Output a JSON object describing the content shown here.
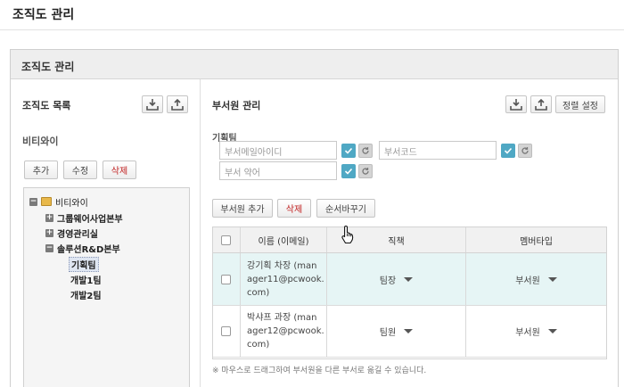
{
  "page": {
    "title": "조직도 관리"
  },
  "panel": {
    "title": "조직도 관리"
  },
  "org_list": {
    "title": "조직도 목록",
    "company": "비티와이",
    "buttons": {
      "add": "추가",
      "edit": "수정",
      "delete": "삭제"
    },
    "tree": {
      "root": "비티와이",
      "nodes": [
        "그룹웨어사업본부",
        "경영관리실",
        "솔루션R&D본부"
      ],
      "children": [
        "기획팀",
        "개발1팀",
        "개발2팀"
      ]
    }
  },
  "member_mgmt": {
    "title": "부서원 관리",
    "sort_label": "정렬 설정",
    "group_name": "기획팀",
    "fields": {
      "mail_id": "부서메일아이디",
      "dept_code": "부서코드",
      "dept_abbr": "부서 약어"
    },
    "actions": {
      "add": "부서원 추가",
      "delete": "삭제",
      "reorder": "순서바꾸기"
    },
    "table": {
      "headers": [
        "이름 (이메일)",
        "직책",
        "멤버타입"
      ],
      "rows": [
        {
          "name": [
            "강기획 차장 (man",
            "ager11@pcwook.",
            "com)"
          ],
          "position": "팀장",
          "member_type": "부서원"
        },
        {
          "name": [
            "박샤프 과장 (man",
            "ager12@pcwook.",
            "com)"
          ],
          "position": "팀원",
          "member_type": "부서원"
        }
      ]
    },
    "note": "※ 마우스로 드래그하여 부서원을 다른 부서로 옮길 수 있습니다."
  },
  "colors": {
    "accent": "#4fa8c4",
    "delete": "#c02020",
    "selected_row": "#e6f5f5"
  },
  "icons": [
    "download-icon",
    "upload-icon",
    "checkmark-icon",
    "refresh-icon",
    "folder-icon",
    "expand-icon",
    "collapse-icon",
    "caret-down-icon",
    "hand-cursor-icon"
  ]
}
